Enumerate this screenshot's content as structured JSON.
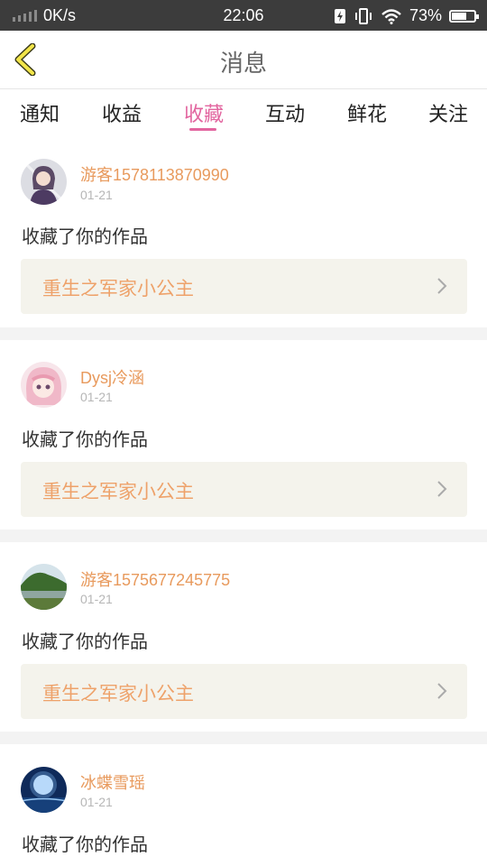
{
  "status_bar": {
    "speed": "0K/s",
    "time": "22:06",
    "battery": "73%",
    "battery_level": 0.73
  },
  "header": {
    "title": "消息"
  },
  "tabs": [
    {
      "label": "通知"
    },
    {
      "label": "收益"
    },
    {
      "label": "收藏",
      "active": true
    },
    {
      "label": "互动"
    },
    {
      "label": "鲜花"
    },
    {
      "label": "关注"
    }
  ],
  "messages": [
    {
      "user": "游客1578113870990",
      "date": "01-21",
      "action": "收藏了你的作品",
      "work_title": "重生之军家小公主",
      "avatar": "anime-girl-avatar"
    },
    {
      "user": "Dysj冷涵",
      "date": "01-21",
      "action": "收藏了你的作品",
      "work_title": "重生之军家小公主",
      "avatar": "pink-hair-girl-avatar"
    },
    {
      "user": "游客1575677245775",
      "date": "01-21",
      "action": "收藏了你的作品",
      "work_title": "重生之军家小公主",
      "avatar": "landscape-avatar"
    },
    {
      "user": "冰蝶雪瑶",
      "date": "01-21",
      "action": "收藏了你的作品",
      "avatar": "moon-night-avatar"
    }
  ],
  "colors": {
    "accent": "#e2659f",
    "username": "#e89a5d",
    "work_title": "#eea26a",
    "work_bg": "#f4f3ec"
  }
}
